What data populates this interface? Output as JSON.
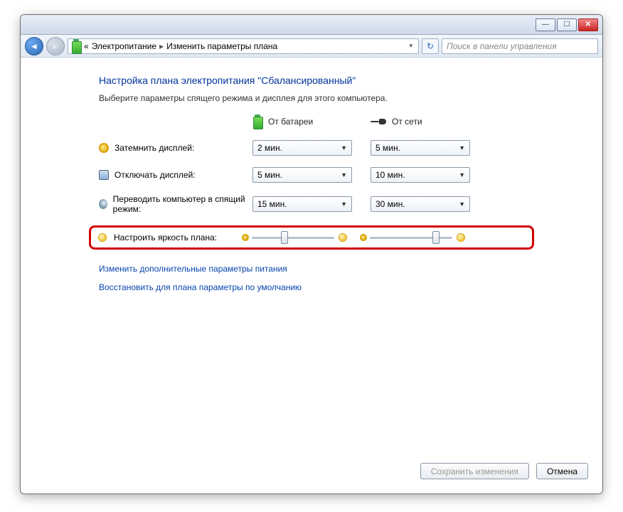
{
  "titlebar": {
    "min": "—",
    "max": "☐",
    "close": "✕"
  },
  "nav": {
    "back_arrow": "◄",
    "fwd_arrow": "►",
    "breadcrumb_pre": "«",
    "breadcrumb_1": "Электропитание",
    "breadcrumb_sep": "▸",
    "breadcrumb_2": "Изменить параметры плана",
    "addr_drop": "▾",
    "refresh": "↻",
    "search_placeholder": "Поиск в панели управления"
  },
  "page": {
    "title": "Настройка плана электропитания \"Сбалансированный\"",
    "sub": "Выберите параметры спящего режима и дисплея для этого компьютера."
  },
  "cols": {
    "battery": "От батареи",
    "ac": "От сети"
  },
  "rows": {
    "dim": {
      "label": "Затемнить дисплей:",
      "battery": "2 мин.",
      "ac": "5 мин."
    },
    "off": {
      "label": "Отключать дисплей:",
      "battery": "5 мин.",
      "ac": "10 мин."
    },
    "sleep": {
      "label": "Переводить компьютер в спящий режим:",
      "battery": "15 мин.",
      "ac": "30 мин."
    },
    "bright": {
      "label": "Настроить яркость плана:",
      "battery_pct": 40,
      "ac_pct": 80
    }
  },
  "links": {
    "advanced": "Изменить дополнительные параметры питания",
    "restore": "Восстановить для плана параметры по умолчанию"
  },
  "buttons": {
    "save": "Сохранить изменения",
    "cancel": "Отмена"
  },
  "combo_arrow": "▼"
}
